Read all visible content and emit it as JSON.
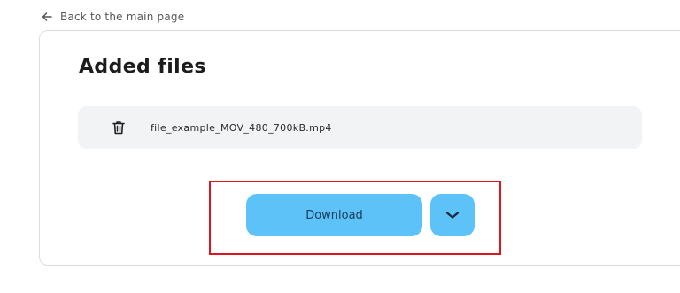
{
  "back_link": {
    "label": "Back to the main page",
    "icon": "arrow-left-icon"
  },
  "card": {
    "title": "Added files"
  },
  "files": [
    {
      "name": "file_example_MOV_480_700kB.mp4",
      "icon": "trash-icon"
    }
  ],
  "actions": {
    "download_label": "Download",
    "dropdown_icon": "chevron-down-icon"
  },
  "colors": {
    "accent": "#5cc2f7",
    "highlight": "#e0141c",
    "row_bg": "#f1f3f5",
    "border": "#d8dde3"
  }
}
